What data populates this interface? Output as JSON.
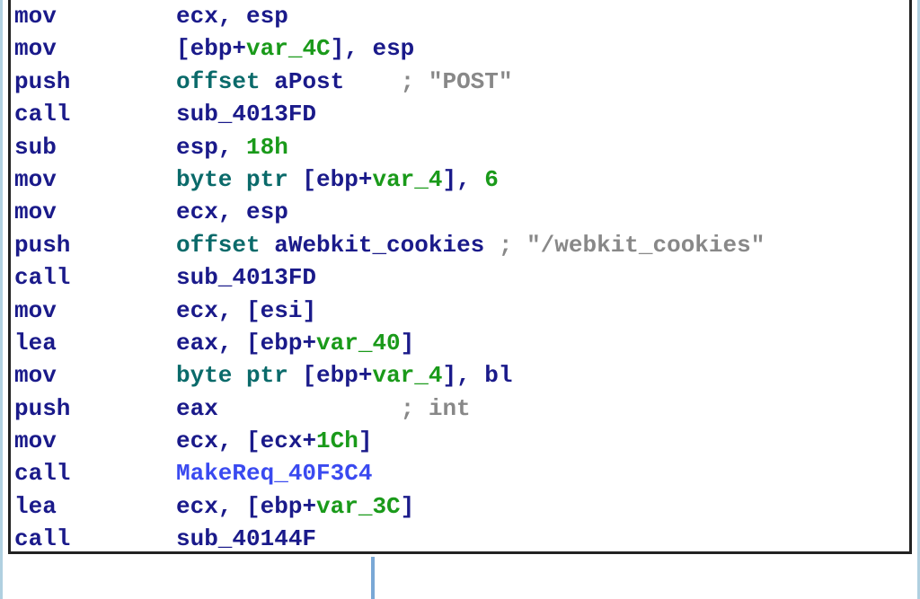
{
  "asm": {
    "lines": [
      {
        "mnemonic": "mov",
        "parts": [
          {
            "cls": "ident-blue",
            "t": "ecx"
          },
          {
            "cls": "punct",
            "t": ", "
          },
          {
            "cls": "ident-blue",
            "t": "esp"
          }
        ]
      },
      {
        "mnemonic": "mov",
        "parts": [
          {
            "cls": "punct",
            "t": "["
          },
          {
            "cls": "ident-blue",
            "t": "ebp"
          },
          {
            "cls": "punct",
            "t": "+"
          },
          {
            "cls": "ident-green",
            "t": "var_4C"
          },
          {
            "cls": "punct",
            "t": "], "
          },
          {
            "cls": "ident-blue",
            "t": "esp"
          }
        ]
      },
      {
        "mnemonic": "push",
        "parts": [
          {
            "cls": "kw-teal",
            "t": "offset"
          },
          {
            "cls": "punct",
            "t": " "
          },
          {
            "cls": "ident-blue",
            "t": "aPost    "
          },
          {
            "cls": "comment",
            "t": "; \"POST\""
          }
        ]
      },
      {
        "mnemonic": "call",
        "parts": [
          {
            "cls": "ident-blue",
            "t": "sub_4013FD"
          }
        ]
      },
      {
        "mnemonic": "sub",
        "parts": [
          {
            "cls": "ident-blue",
            "t": "esp"
          },
          {
            "cls": "punct",
            "t": ", "
          },
          {
            "cls": "num-green",
            "t": "18h"
          }
        ]
      },
      {
        "mnemonic": "mov",
        "parts": [
          {
            "cls": "kw-teal",
            "t": "byte ptr"
          },
          {
            "cls": "punct",
            "t": " ["
          },
          {
            "cls": "ident-blue",
            "t": "ebp"
          },
          {
            "cls": "punct",
            "t": "+"
          },
          {
            "cls": "ident-green",
            "t": "var_4"
          },
          {
            "cls": "punct",
            "t": "], "
          },
          {
            "cls": "num-green",
            "t": "6"
          }
        ]
      },
      {
        "mnemonic": "mov",
        "parts": [
          {
            "cls": "ident-blue",
            "t": "ecx"
          },
          {
            "cls": "punct",
            "t": ", "
          },
          {
            "cls": "ident-blue",
            "t": "esp"
          }
        ]
      },
      {
        "mnemonic": "push",
        "parts": [
          {
            "cls": "kw-teal",
            "t": "offset"
          },
          {
            "cls": "punct",
            "t": " "
          },
          {
            "cls": "ident-blue",
            "t": "aWebkit_cookies "
          },
          {
            "cls": "comment",
            "t": "; \"/webkit_cookies\""
          }
        ]
      },
      {
        "mnemonic": "call",
        "parts": [
          {
            "cls": "ident-blue",
            "t": "sub_4013FD"
          }
        ]
      },
      {
        "mnemonic": "mov",
        "parts": [
          {
            "cls": "ident-blue",
            "t": "ecx"
          },
          {
            "cls": "punct",
            "t": ", ["
          },
          {
            "cls": "ident-blue",
            "t": "esi"
          },
          {
            "cls": "punct",
            "t": "]"
          }
        ]
      },
      {
        "mnemonic": "lea",
        "parts": [
          {
            "cls": "ident-blue",
            "t": "eax"
          },
          {
            "cls": "punct",
            "t": ", ["
          },
          {
            "cls": "ident-blue",
            "t": "ebp"
          },
          {
            "cls": "punct",
            "t": "+"
          },
          {
            "cls": "ident-green",
            "t": "var_40"
          },
          {
            "cls": "punct",
            "t": "]"
          }
        ]
      },
      {
        "mnemonic": "mov",
        "parts": [
          {
            "cls": "kw-teal",
            "t": "byte ptr"
          },
          {
            "cls": "punct",
            "t": " ["
          },
          {
            "cls": "ident-blue",
            "t": "ebp"
          },
          {
            "cls": "punct",
            "t": "+"
          },
          {
            "cls": "ident-green",
            "t": "var_4"
          },
          {
            "cls": "punct",
            "t": "], "
          },
          {
            "cls": "ident-blue",
            "t": "bl"
          }
        ]
      },
      {
        "mnemonic": "push",
        "parts": [
          {
            "cls": "ident-blue",
            "t": "eax             "
          },
          {
            "cls": "comment",
            "t": "; int"
          }
        ]
      },
      {
        "mnemonic": "mov",
        "parts": [
          {
            "cls": "ident-blue",
            "t": "ecx"
          },
          {
            "cls": "punct",
            "t": ", ["
          },
          {
            "cls": "ident-blue",
            "t": "ecx"
          },
          {
            "cls": "punct",
            "t": "+"
          },
          {
            "cls": "num-green",
            "t": "1Ch"
          },
          {
            "cls": "punct",
            "t": "]"
          }
        ]
      },
      {
        "mnemonic": "call",
        "parts": [
          {
            "cls": "func-blue",
            "t": "MakeReq_40F3C4"
          }
        ]
      },
      {
        "mnemonic": "lea",
        "parts": [
          {
            "cls": "ident-blue",
            "t": "ecx"
          },
          {
            "cls": "punct",
            "t": ", ["
          },
          {
            "cls": "ident-blue",
            "t": "ebp"
          },
          {
            "cls": "punct",
            "t": "+"
          },
          {
            "cls": "ident-green",
            "t": "var_3C"
          },
          {
            "cls": "punct",
            "t": "]"
          }
        ]
      },
      {
        "mnemonic": "call",
        "parts": [
          {
            "cls": "ident-blue",
            "t": "sub_40144F"
          }
        ]
      }
    ]
  }
}
